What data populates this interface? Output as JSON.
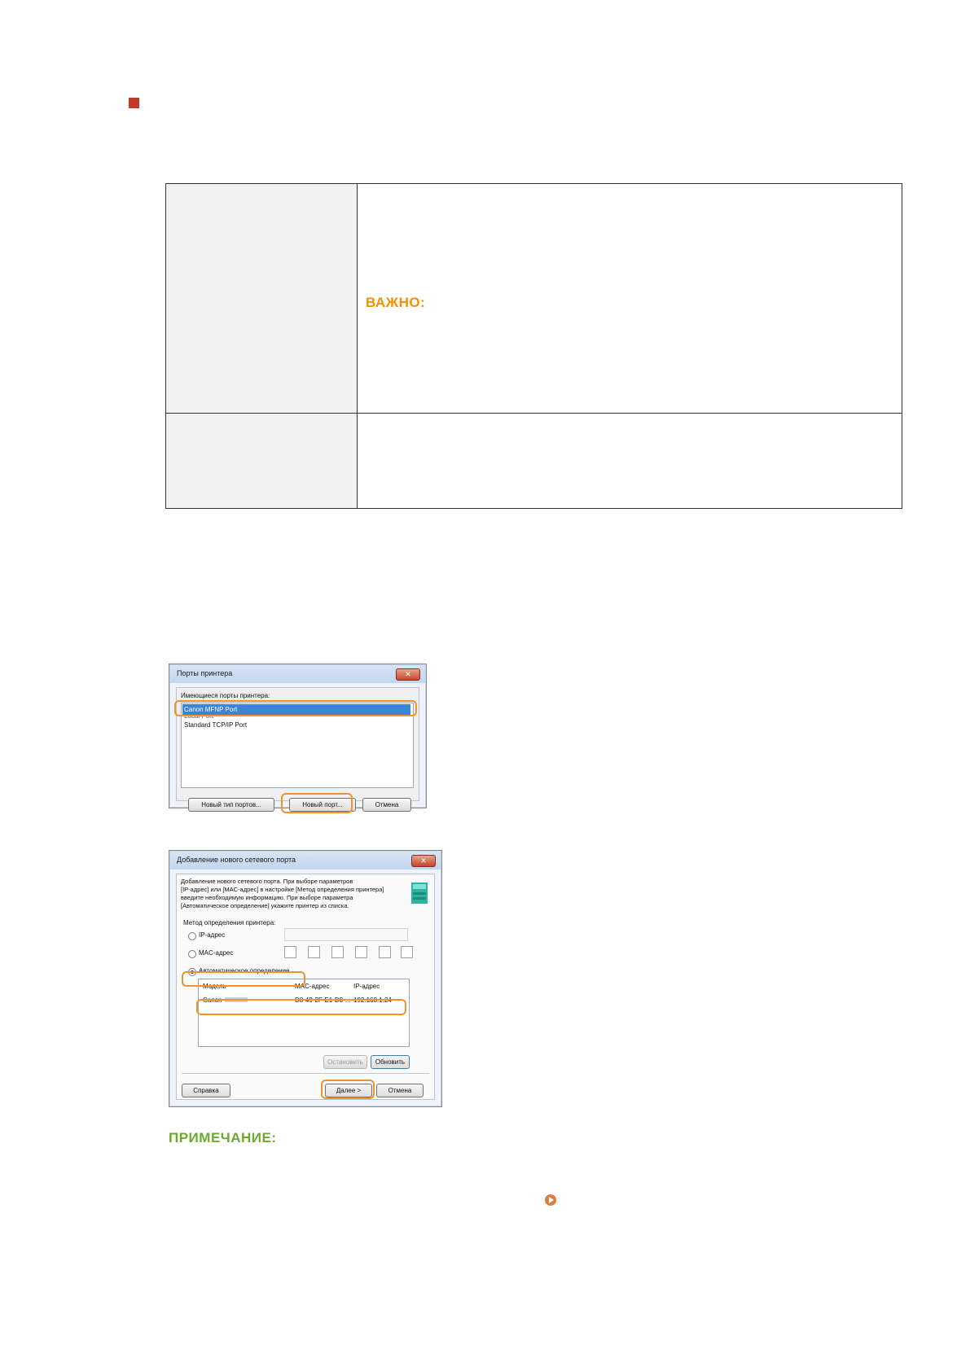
{
  "table": {
    "important_label": "ВАЖНО:"
  },
  "dialog1": {
    "title": "Порты принтера",
    "close_label": "✕",
    "list_label": "Имеющиеся порты принтера:",
    "ports": [
      "Canon MFNP Port",
      "Local Port",
      "Standard TCP/IP Port"
    ],
    "btn_new_type": "Новый тип портов...",
    "btn_new_port": "Новый порт...",
    "btn_cancel": "Отмена"
  },
  "dialog2": {
    "title": "Добавление нового сетевого порта",
    "close_label": "✕",
    "description": [
      "Добавление нового сетевого порта. При выборе параметров",
      "[IP-адрес] или [MAC-адрес] в настройке [Метод определения принтера]",
      "введите необходимую информацию. При выборе параметра",
      "[Автоматическое определение] укажите принтер из списка."
    ],
    "group_label": "Метод определения принтера:",
    "radio_ip": "IP-адрес",
    "radio_mac": "MAC-адрес",
    "radio_auto": "Автоматическое определение",
    "col_model": "Модель",
    "col_mac": "MAC-адрес",
    "col_ip": "IP-адрес",
    "row_model": "Canon",
    "row_mac": "D8-49-2F-E1-D8-...",
    "row_ip": "192.168.1.24",
    "btn_stop": "Остановить",
    "btn_refresh": "Обновить",
    "btn_help": "Справка",
    "btn_next": "Далее >",
    "btn_cancel": "Отмена"
  },
  "note_label": "ПРИМЕЧАНИЕ:",
  "colors": {
    "bullet": "#c0392b",
    "important": "#f29100",
    "note": "#6aab2d",
    "highlight": "#f0932b"
  }
}
